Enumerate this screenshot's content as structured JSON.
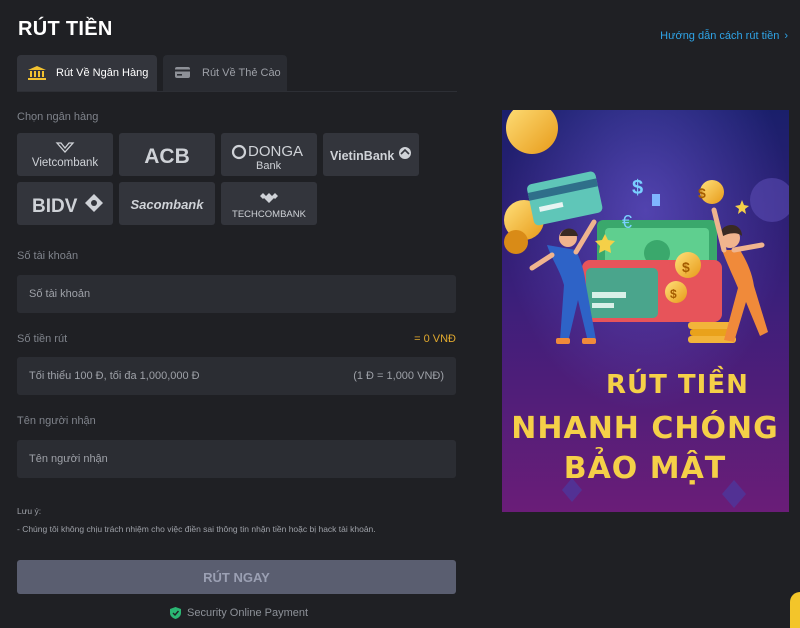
{
  "header": {
    "title": "RÚT TIỀN",
    "guide_link": "Hướng dẫn cách rút tiền"
  },
  "tabs": [
    {
      "label": "Rút Về Ngân Hàng",
      "icon": "bank-icon",
      "active": true
    },
    {
      "label": "Rút Về Thẻ Cào",
      "icon": "card-icon",
      "active": false
    }
  ],
  "bank_section": {
    "label": "Chọn ngân hàng",
    "banks": [
      "Vietcombank",
      "ACB",
      "DONGA Bank",
      "VietinBank",
      "BIDV",
      "Sacombank",
      "TECHCOMBANK"
    ],
    "logo_text": {
      "vietcombank": "Vietcombank",
      "acb": "ACB",
      "donga_top": "DONGA",
      "donga_bottom": "Bank",
      "vietinbank": "VietinBank",
      "bidv": "BIDV",
      "sacombank": "Sacombank",
      "techcombank": "TECHCOMBANK"
    }
  },
  "form": {
    "account": {
      "label": "Số tài khoản",
      "placeholder": "Số tài khoản"
    },
    "amount": {
      "label": "Số tiền rút",
      "value_display": "= 0 VNĐ",
      "placeholder": "Tối thiểu 100 Đ, tối đa 1,000,000 Đ",
      "rate_hint": "(1 Đ = 1,000 VNĐ)"
    },
    "recipient": {
      "label": "Tên người nhận",
      "placeholder": "Tên người nhận"
    }
  },
  "note": {
    "title": "Lưu ý:",
    "text": "- Chúng tôi không chịu trách nhiệm cho việc điền sai thông tin nhận tiền hoặc bị hack tài khoản."
  },
  "submit": {
    "label": "RÚT NGAY"
  },
  "security": {
    "label": "Security Online Payment"
  },
  "banner": {
    "line1": "RÚT TIỀN",
    "line2": "NHANH CHÓNG",
    "line3": "BẢO MẬT"
  },
  "colors": {
    "background": "#1f2024",
    "accent_link": "#2fa4e7",
    "amount_value": "#e0a82e",
    "banner_text": "#f5d048"
  }
}
